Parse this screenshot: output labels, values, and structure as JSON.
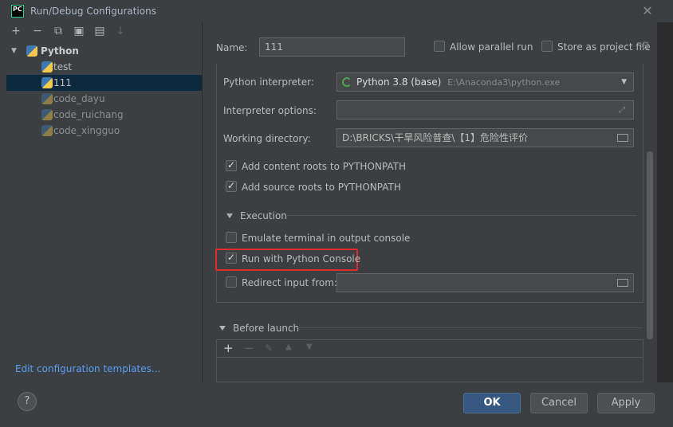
{
  "window": {
    "logo_text": "PC",
    "title": "Run/Debug Configurations",
    "close_glyph": "✕"
  },
  "left": {
    "toolbar": {
      "add": "+",
      "remove": "−",
      "copy": "⧉",
      "save": "▣",
      "folder": "▤",
      "sort": "↓"
    },
    "tree": {
      "root": "Python",
      "items": [
        "test",
        "111",
        "code_dayu",
        "code_ruichang",
        "code_xingguo"
      ]
    },
    "edit_templates_link": "Edit configuration templates..."
  },
  "header": {
    "name_label": "Name:",
    "name_value": "111",
    "allow_parallel": "Allow parallel run",
    "store_project": "Store as project file"
  },
  "config": {
    "interpreter_label": "Python interpreter:",
    "interpreter_name": "Python 3.8 (base)",
    "interpreter_path": "E:\\Anaconda3\\python.exe",
    "options_label": "Interpreter options:",
    "options_value": "",
    "workdir_label": "Working directory:",
    "workdir_value": "D:\\BRICKS\\干旱风险普查\\【1】危险性评价",
    "content_roots": "Add content roots to PYTHONPATH",
    "source_roots": "Add source roots to PYTHONPATH",
    "execution_title": "Execution",
    "emulate_terminal": "Emulate terminal in output console",
    "run_console": "Run with Python Console",
    "redirect_input": "Redirect input from:",
    "redirect_value": ""
  },
  "before_launch": {
    "title": "Before launch"
  },
  "buttons": {
    "help": "?",
    "ok": "OK",
    "cancel": "Cancel",
    "apply": "Apply"
  },
  "colors": {
    "accent": "#365880",
    "highlight": "#e12a2a",
    "link": "#589df6"
  }
}
